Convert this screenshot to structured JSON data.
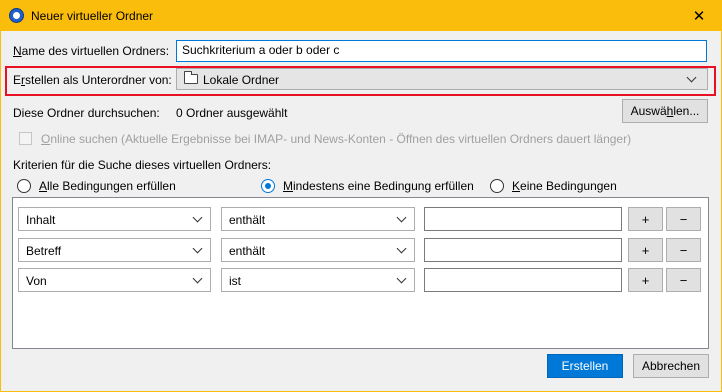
{
  "window": {
    "title": "Neuer virtueller Ordner",
    "close_glyph": "✕"
  },
  "form": {
    "name_label_prefix": "",
    "name_label_mnemonic": "N",
    "name_label_rest": "ame des virtuellen Ordners:",
    "name_value": "Suchkriterium a oder b oder c",
    "parent_label_prefix": "E",
    "parent_label_mnemonic": "r",
    "parent_label_rest": "stellen als Unterordner von:",
    "parent_value": "Lokale Ordner",
    "search_folders_label": "Diese Ordner durchsuchen:",
    "search_folders_value": "0 Ordner ausgewählt",
    "choose_button_prefix": "Auswä",
    "choose_button_mnemonic": "h",
    "choose_button_rest": "len...",
    "online_mnemonic": "O",
    "online_rest": "nline suchen (Aktuelle Ergebnisse bei IMAP- und News-Konten - Öffnen des virtuellen Ordners dauert länger)",
    "online_checked": false,
    "criteria_label": "Kriterien für die Suche dieses virtuellen Ordners:"
  },
  "match": {
    "options": [
      {
        "mnemonic": "A",
        "rest": "lle Bedingungen erfüllen",
        "checked": false
      },
      {
        "mnemonic": "M",
        "rest": "indestens eine Bedingung erfüllen",
        "checked": true
      },
      {
        "mnemonic": "K",
        "rest": "eine Bedingungen",
        "checked": false
      }
    ]
  },
  "criteria": [
    {
      "field": "Inhalt",
      "operator": "enthält",
      "value": ""
    },
    {
      "field": "Betreff",
      "operator": "enthält",
      "value": ""
    },
    {
      "field": "Von",
      "operator": "ist",
      "value": ""
    }
  ],
  "row_buttons": {
    "add": "+",
    "remove": "−"
  },
  "footer": {
    "create_label": "Erstellen",
    "cancel_label": "Abbrechen"
  },
  "colors": {
    "titlebar": "#fbbd0c",
    "accent": "#0078d7",
    "highlight": "#e81123"
  }
}
